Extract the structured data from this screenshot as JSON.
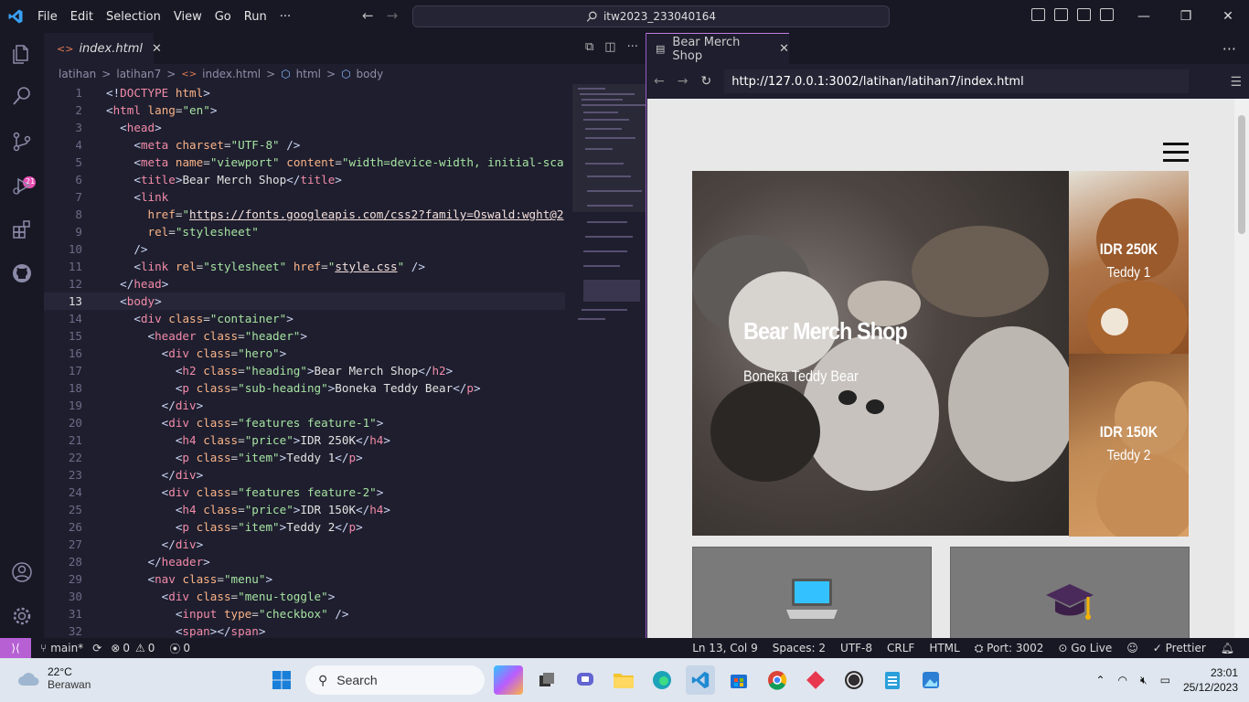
{
  "titlebar": {
    "menus": [
      "File",
      "Edit",
      "Selection",
      "View",
      "Go",
      "Run",
      "···"
    ],
    "search": "itw2023_233040164"
  },
  "editor": {
    "tab": {
      "name": "index.html"
    },
    "breadcrumb": [
      "latihan",
      ">",
      "latihan7",
      ">",
      "index.html",
      ">",
      "html",
      ">",
      "body"
    ]
  },
  "code": [
    {
      "n": "1",
      "html": "<span class='t-br'>&lt;!</span><span class='t-tag'>DOCTYPE</span> <span class='t-attr'>html</span><span class='t-br'>&gt;</span>"
    },
    {
      "n": "2",
      "html": "<span class='t-br'>&lt;</span><span class='t-tag'>html</span> <span class='t-attr'>lang</span>=<span class='t-str'>\"en\"</span><span class='t-br'>&gt;</span>"
    },
    {
      "n": "3",
      "html": "  <span class='t-br'>&lt;</span><span class='t-tag'>head</span><span class='t-br'>&gt;</span>"
    },
    {
      "n": "4",
      "html": "    <span class='t-br'>&lt;</span><span class='t-tag'>meta</span> <span class='t-attr'>charset</span>=<span class='t-str'>\"UTF-8\"</span> <span class='t-br'>/&gt;</span>"
    },
    {
      "n": "5",
      "html": "    <span class='t-br'>&lt;</span><span class='t-tag'>meta</span> <span class='t-attr'>name</span>=<span class='t-str'>\"viewport\"</span> <span class='t-attr'>content</span>=<span class='t-str'>\"width=device-width, initial-sca</span>"
    },
    {
      "n": "6",
      "html": "    <span class='t-br'>&lt;</span><span class='t-tag'>title</span><span class='t-br'>&gt;</span><span class='t-txt'>Bear Merch Shop</span><span class='t-br'>&lt;/</span><span class='t-tag'>title</span><span class='t-br'>&gt;</span>"
    },
    {
      "n": "7",
      "html": "    <span class='t-br'>&lt;</span><span class='t-tag'>link</span>"
    },
    {
      "n": "8",
      "html": "      <span class='t-attr'>href</span>=<span class='t-str'>\"</span><span class='t-url'>https://fonts.googleapis.com/css2?family=Oswald:wght@2</span>"
    },
    {
      "n": "9",
      "html": "      <span class='t-attr'>rel</span>=<span class='t-str'>\"stylesheet\"</span>"
    },
    {
      "n": "10",
      "html": "    <span class='t-br'>/&gt;</span>"
    },
    {
      "n": "11",
      "html": "    <span class='t-br'>&lt;</span><span class='t-tag'>link</span> <span class='t-attr'>rel</span>=<span class='t-str'>\"stylesheet\"</span> <span class='t-attr'>href</span>=<span class='t-str'>\"</span><span class='t-url'>style.css</span><span class='t-str'>\"</span> <span class='t-br'>/&gt;</span>"
    },
    {
      "n": "12",
      "html": "  <span class='t-br'>&lt;/</span><span class='t-tag'>head</span><span class='t-br'>&gt;</span>"
    },
    {
      "n": "13",
      "html": "  <span class='t-br'>&lt;</span><span class='t-tag'>body</span><span class='t-br'>&gt;</span>",
      "cur": true
    },
    {
      "n": "14",
      "html": "    <span class='t-br'>&lt;</span><span class='t-tag'>div</span> <span class='t-attr'>class</span>=<span class='t-str'>\"container\"</span><span class='t-br'>&gt;</span>"
    },
    {
      "n": "15",
      "html": "      <span class='t-br'>&lt;</span><span class='t-tag'>header</span> <span class='t-attr'>class</span>=<span class='t-str'>\"header\"</span><span class='t-br'>&gt;</span>"
    },
    {
      "n": "16",
      "html": "        <span class='t-br'>&lt;</span><span class='t-tag'>div</span> <span class='t-attr'>class</span>=<span class='t-str'>\"hero\"</span><span class='t-br'>&gt;</span>"
    },
    {
      "n": "17",
      "html": "          <span class='t-br'>&lt;</span><span class='t-tag'>h2</span> <span class='t-attr'>class</span>=<span class='t-str'>\"heading\"</span><span class='t-br'>&gt;</span><span class='t-txt'>Bear Merch Shop</span><span class='t-br'>&lt;/</span><span class='t-tag'>h2</span><span class='t-br'>&gt;</span>"
    },
    {
      "n": "18",
      "html": "          <span class='t-br'>&lt;</span><span class='t-tag'>p</span> <span class='t-attr'>class</span>=<span class='t-str'>\"sub-heading\"</span><span class='t-br'>&gt;</span><span class='t-txt'>Boneka Teddy Bear</span><span class='t-br'>&lt;/</span><span class='t-tag'>p</span><span class='t-br'>&gt;</span>"
    },
    {
      "n": "19",
      "html": "        <span class='t-br'>&lt;/</span><span class='t-tag'>div</span><span class='t-br'>&gt;</span>"
    },
    {
      "n": "20",
      "html": "        <span class='t-br'>&lt;</span><span class='t-tag'>div</span> <span class='t-attr'>class</span>=<span class='t-str'>\"features feature-1\"</span><span class='t-br'>&gt;</span>"
    },
    {
      "n": "21",
      "html": "          <span class='t-br'>&lt;</span><span class='t-tag'>h4</span> <span class='t-attr'>class</span>=<span class='t-str'>\"price\"</span><span class='t-br'>&gt;</span><span class='t-txt'>IDR 250K</span><span class='t-br'>&lt;/</span><span class='t-tag'>h4</span><span class='t-br'>&gt;</span>"
    },
    {
      "n": "22",
      "html": "          <span class='t-br'>&lt;</span><span class='t-tag'>p</span> <span class='t-attr'>class</span>=<span class='t-str'>\"item\"</span><span class='t-br'>&gt;</span><span class='t-txt'>Teddy 1</span><span class='t-br'>&lt;/</span><span class='t-tag'>p</span><span class='t-br'>&gt;</span>"
    },
    {
      "n": "23",
      "html": "        <span class='t-br'>&lt;/</span><span class='t-tag'>div</span><span class='t-br'>&gt;</span>"
    },
    {
      "n": "24",
      "html": "        <span class='t-br'>&lt;</span><span class='t-tag'>div</span> <span class='t-attr'>class</span>=<span class='t-str'>\"features feature-2\"</span><span class='t-br'>&gt;</span>"
    },
    {
      "n": "25",
      "html": "          <span class='t-br'>&lt;</span><span class='t-tag'>h4</span> <span class='t-attr'>class</span>=<span class='t-str'>\"price\"</span><span class='t-br'>&gt;</span><span class='t-txt'>IDR 150K</span><span class='t-br'>&lt;/</span><span class='t-tag'>h4</span><span class='t-br'>&gt;</span>"
    },
    {
      "n": "26",
      "html": "          <span class='t-br'>&lt;</span><span class='t-tag'>p</span> <span class='t-attr'>class</span>=<span class='t-str'>\"item\"</span><span class='t-br'>&gt;</span><span class='t-txt'>Teddy 2</span><span class='t-br'>&lt;/</span><span class='t-tag'>p</span><span class='t-br'>&gt;</span>"
    },
    {
      "n": "27",
      "html": "        <span class='t-br'>&lt;/</span><span class='t-tag'>div</span><span class='t-br'>&gt;</span>"
    },
    {
      "n": "28",
      "html": "      <span class='t-br'>&lt;/</span><span class='t-tag'>header</span><span class='t-br'>&gt;</span>"
    },
    {
      "n": "29",
      "html": "      <span class='t-br'>&lt;</span><span class='t-tag'>nav</span> <span class='t-attr'>class</span>=<span class='t-str'>\"menu\"</span><span class='t-br'>&gt;</span>"
    },
    {
      "n": "30",
      "html": "        <span class='t-br'>&lt;</span><span class='t-tag'>div</span> <span class='t-attr'>class</span>=<span class='t-str'>\"menu-toggle\"</span><span class='t-br'>&gt;</span>"
    },
    {
      "n": "31",
      "html": "          <span class='t-br'>&lt;</span><span class='t-tag'>input</span> <span class='t-attr'>type</span>=<span class='t-str'>\"checkbox\"</span> <span class='t-br'>/&gt;</span>"
    },
    {
      "n": "32",
      "html": "          <span class='t-br'>&lt;</span><span class='t-tag'>span</span><span class='t-br'>&gt;&lt;/</span><span class='t-tag'>span</span><span class='t-br'>&gt;</span>"
    }
  ],
  "browser": {
    "tab_title": "Bear Merch Shop",
    "url": "http://127.0.0.1:3002/latihan/latihan7/index.html"
  },
  "site": {
    "heading": "Bear Merch Shop",
    "subheading": "Boneka Teddy Bear",
    "features": [
      {
        "price": "IDR 250K",
        "item": "Teddy 1"
      },
      {
        "price": "IDR 150K",
        "item": "Teddy 2"
      }
    ]
  },
  "status": {
    "branch": "main*",
    "errors": "0",
    "warnings": "0",
    "ports": "0",
    "position": "Ln 13, Col 9",
    "spaces": "Spaces: 2",
    "encoding": "UTF-8",
    "eol": "CRLF",
    "lang": "HTML",
    "port": "Port: 3002",
    "golive": "Go Live",
    "prettier": "Prettier"
  },
  "taskbar": {
    "temp": "22°C",
    "weather": "Berawan",
    "search": "Search",
    "time": "23:01",
    "date": "25/12/2023"
  },
  "scm_badge": "21"
}
